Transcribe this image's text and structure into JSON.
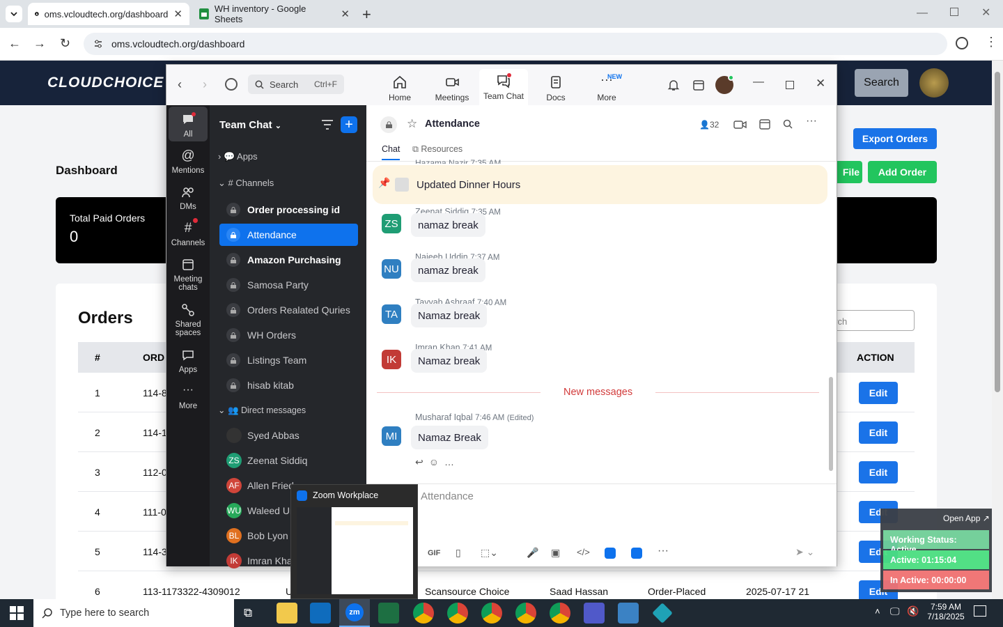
{
  "browser": {
    "tabs": [
      {
        "title": "oms.vcloudtech.org/dashboard",
        "active": true
      },
      {
        "title": "WH inventory - Google Sheets",
        "active": false
      }
    ],
    "url": "oms.vcloudtech.org/dashboard"
  },
  "site": {
    "logo": "CLOUDCHOICE",
    "search_button": "Search",
    "export_button": "Export Orders",
    "file_button": "File",
    "add_order_button": "Add Order",
    "page_title": "Dashboard",
    "card_label": "Total Paid Orders",
    "card_value": "0",
    "orders_title": "Orders",
    "search_placeholder": "arch",
    "table": {
      "col_num": "#",
      "col_order": "ORD",
      "col_action": "ACTION",
      "rows": [
        {
          "n": "1",
          "order": "114-8",
          "action": "Edit"
        },
        {
          "n": "2",
          "order": "114-1",
          "action": "Edit"
        },
        {
          "n": "3",
          "order": "112-0",
          "action": "Edit"
        },
        {
          "n": "4",
          "order": "111-0",
          "action": "Edit"
        },
        {
          "n": "5",
          "order": "114-3",
          "action": "Edit"
        },
        {
          "n": "6",
          "order": "113-1173322-4309012",
          "col3": "U",
          "store": "Scansource Choice",
          "buyer": "Saad Hassan",
          "status": "Order-Placed",
          "date": "2025-07-17 21",
          "action": "Edit"
        }
      ]
    }
  },
  "zoom": {
    "search_placeholder": "Search",
    "search_shortcut": "Ctrl+F",
    "nav": [
      {
        "label": "Home"
      },
      {
        "label": "Meetings"
      },
      {
        "label": "Team Chat"
      },
      {
        "label": "Docs"
      },
      {
        "label": "More",
        "badge": "NEW"
      }
    ],
    "rail": [
      "All",
      "Mentions",
      "DMs",
      "Channels",
      "Meeting chats",
      "Shared spaces",
      "Apps",
      "More"
    ],
    "list_title": "Team Chat",
    "apps_label": "Apps",
    "channels_label": "Channels",
    "channels": [
      {
        "name": "Order processing id",
        "bold": true
      },
      {
        "name": "Attendance",
        "selected": true
      },
      {
        "name": "Amazon Purchasing",
        "bold": true
      },
      {
        "name": "Samosa Party"
      },
      {
        "name": "Orders Realated Quries"
      },
      {
        "name": "WH Orders"
      },
      {
        "name": "Listings Team"
      },
      {
        "name": "hisab kitab"
      }
    ],
    "dm_label": "Direct messages",
    "dms": [
      {
        "name": "Syed Abbas",
        "initials": "",
        "color": "#333333"
      },
      {
        "name": "Zeenat Siddiq",
        "initials": "ZS",
        "color": "#1f9d74"
      },
      {
        "name": "Allen Fried",
        "initials": "AF",
        "color": "#d0453a"
      },
      {
        "name": "Waleed Ur",
        "initials": "WU",
        "color": "#27a85a"
      },
      {
        "name": "Bob Lyon",
        "initials": "BL",
        "color": "#e0701f"
      },
      {
        "name": "Imran Khan",
        "initials": "IK",
        "color": "#c23b36"
      }
    ],
    "chat": {
      "title": "Attendance",
      "members": "32",
      "tabs": [
        "Chat",
        "Resources"
      ],
      "prev_header": "Hazama Nazir 7:35 AM",
      "pinned": "Updated Dinner Hours",
      "messages": [
        {
          "name": "Zeenat Siddiq",
          "time": "7:35 AM",
          "text": "namaz break",
          "initials": "ZS",
          "color": "#1f9d74"
        },
        {
          "name": "Najeeb Uddin",
          "time": "7:37 AM",
          "text": "namaz break",
          "initials": "NU",
          "color": "#2f7fc1"
        },
        {
          "name": "Tayyab Ashraaf",
          "time": "7:40 AM",
          "text": "Namaz break",
          "initials": "TA",
          "color": "#2f7fc1"
        },
        {
          "name": "Imran Khan",
          "time": "7:41 AM",
          "text": "Namaz break",
          "initials": "IK",
          "color": "#c23b36"
        }
      ],
      "new_messages": "New messages",
      "last": {
        "name": "Musharaf Iqbal",
        "time": "7:46 AM",
        "edited": "(Edited)",
        "text": "Namaz Break",
        "initials": "MI",
        "color": "#2f7fc1"
      },
      "composer_placeholder": "Attendance",
      "gif_label": "GIF"
    },
    "preview_title": "Zoom Workplace"
  },
  "status_widget": {
    "open_app": "Open App ↗",
    "working": "Working Status: Active",
    "active": "Active: 01:15:04",
    "inactive": "In Active: 00:00:00"
  },
  "taskbar": {
    "search_placeholder": "Type here to search",
    "time": "7:59 AM",
    "date": "7/18/2025"
  }
}
